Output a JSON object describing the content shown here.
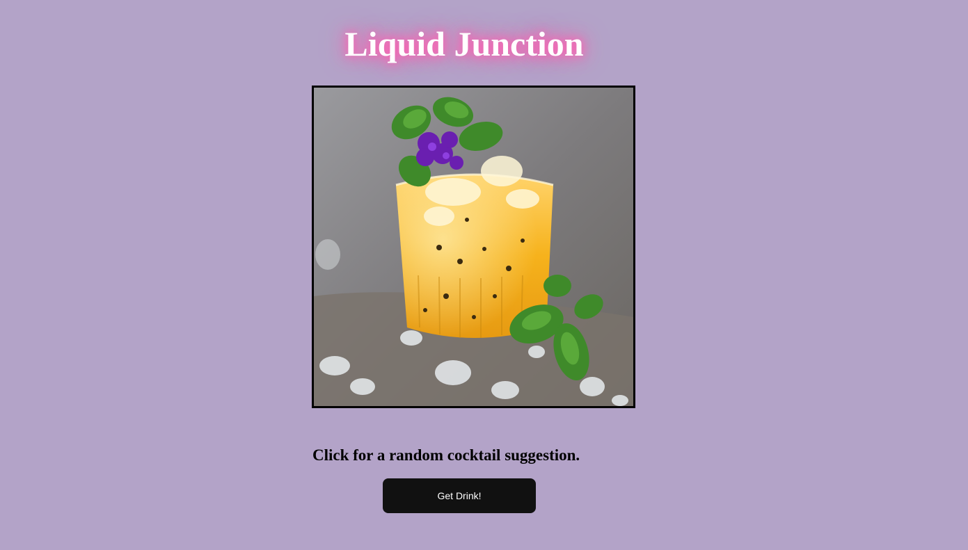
{
  "header": {
    "title": "Liquid Junction"
  },
  "image": {
    "alt": "Passion fruit cocktail with crushed ice, mint and purple flower garnish"
  },
  "main": {
    "prompt": "Click for a random cocktail suggestion."
  },
  "button": {
    "label": "Get Drink!"
  },
  "colors": {
    "background": "#b3a3c8",
    "title_glow": "#ff5fb1",
    "button": "#111111"
  }
}
